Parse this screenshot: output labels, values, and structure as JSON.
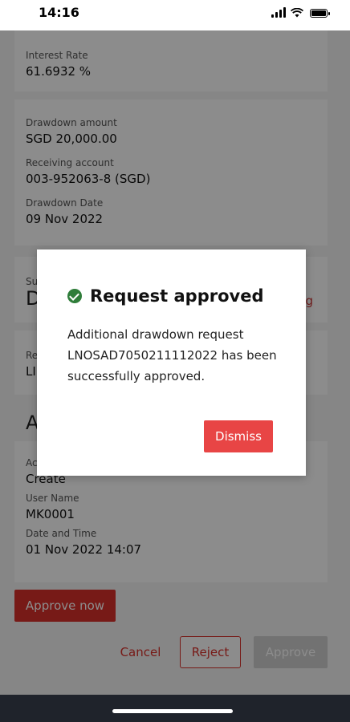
{
  "status_bar": {
    "time": "14:16",
    "icons": [
      "signal-icon",
      "wifi-icon",
      "battery-icon"
    ]
  },
  "details": {
    "interest_rate_label": "Interest Rate",
    "interest_rate_value": "61.6932 %",
    "drawdown_amount_label": "Drawdown amount",
    "drawdown_amount_value": "SGD 20,000.00",
    "receiving_account_label": "Receiving account",
    "receiving_account_value": "003-952063-8 (SGD)",
    "drawdown_date_label": "Drawdown Date",
    "drawdown_date_value": "09 Nov 2022",
    "partial_su": "Su",
    "partial_d": "D",
    "partial_red_g": "g",
    "partial_re": "Re",
    "partial_ln": "LI",
    "partial_a": "A",
    "partial_ac": "Ac"
  },
  "activity": {
    "action_value": "Create",
    "user_name_label": "User Name",
    "user_name_value": "MK0001",
    "date_time_label": "Date and Time",
    "date_time_value": "01 Nov 2022 14:07"
  },
  "buttons": {
    "approve_now": "Approve now",
    "cancel": "Cancel",
    "reject": "Reject",
    "approve": "Approve"
  },
  "modal": {
    "title": "Request approved",
    "message": "Additional drawdown request LNOSAD7050211112022 has been successfully approved.",
    "dismiss": "Dismiss"
  },
  "colors": {
    "accent_red": "#d9302a",
    "dismiss_red": "#e84545",
    "success_green": "#2f7d3a"
  }
}
